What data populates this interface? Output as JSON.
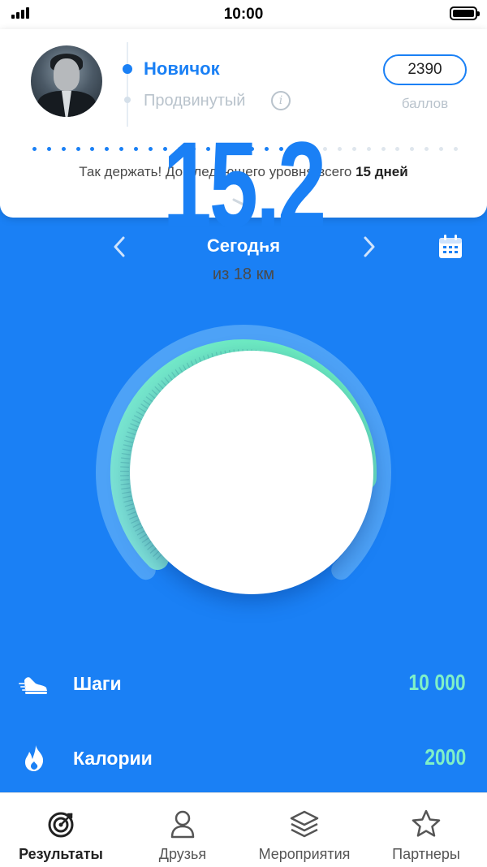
{
  "status_bar": {
    "time": "10:00"
  },
  "profile": {
    "level_current": "Новичок",
    "level_next": "Продвинутый",
    "points": "2390",
    "points_label": "баллов",
    "encourage_prefix": "Так держать! До следующего уровня всего ",
    "encourage_days": "15 дней",
    "progress": {
      "filled": 18,
      "total": 30
    }
  },
  "date_nav": {
    "label": "Сегодня"
  },
  "gauge": {
    "value": "15,2",
    "goal_text": "из 18 км",
    "progress_fraction": 0.844,
    "colors": {
      "start": "#7ee0d9",
      "end": "#6af0bd",
      "track": "#4da2f7"
    }
  },
  "stats": [
    {
      "label": "Шаги",
      "value": "10 000",
      "icon": "shoe-icon"
    },
    {
      "label": "Калории",
      "value": "2000",
      "icon": "flame-icon"
    }
  ],
  "tabs": [
    {
      "label": "Результаты",
      "icon": "target-icon",
      "active": true
    },
    {
      "label": "Друзья",
      "icon": "person-icon",
      "active": false
    },
    {
      "label": "Мероприятия",
      "icon": "layers-icon",
      "active": false
    },
    {
      "label": "Партнеры",
      "icon": "star-icon",
      "active": false
    }
  ],
  "colors": {
    "primary": "#1a80f5",
    "accent": "#7ff0c7",
    "card": "#ffffff"
  }
}
